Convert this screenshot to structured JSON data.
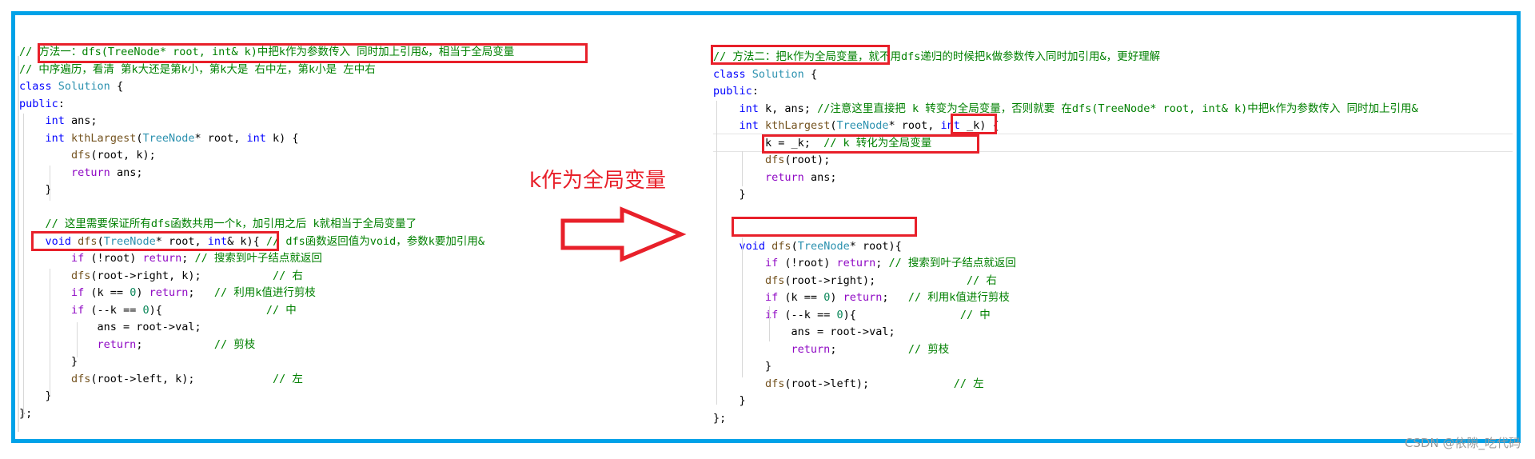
{
  "annotation": {
    "label": "k作为全局变量",
    "arrow_icon": "right-arrow",
    "accent_color": "#e8202a",
    "frame_color": "#00a2e8"
  },
  "left_panel": {
    "title": "方法一",
    "lines": [
      [
        {
          "t": "cm",
          "v": "// "
        },
        {
          "t": "cm",
          "v": "方法一：dfs(TreeNode* root, int& k)中把k作为参数传入 同时加上引用&，相当于全局变量"
        }
      ],
      [
        {
          "t": "cm",
          "v": "// 中序遍历，看清 第k大还是第k小，第k大是 右中左，第k小是 左中右"
        }
      ],
      [
        {
          "t": "kw",
          "v": "class "
        },
        {
          "t": "cls",
          "v": "Solution"
        },
        {
          "t": "txt",
          "v": " {"
        }
      ],
      [
        {
          "t": "kw",
          "v": "public"
        },
        {
          "t": "txt",
          "v": ":"
        }
      ],
      [
        {
          "t": "txt",
          "v": "    "
        },
        {
          "t": "kw",
          "v": "int"
        },
        {
          "t": "txt",
          "v": " ans;"
        }
      ],
      [
        {
          "t": "txt",
          "v": "    "
        },
        {
          "t": "kw",
          "v": "int"
        },
        {
          "t": "txt",
          "v": " "
        },
        {
          "t": "fn",
          "v": "kthLargest"
        },
        {
          "t": "txt",
          "v": "("
        },
        {
          "t": "cls",
          "v": "TreeNode"
        },
        {
          "t": "txt",
          "v": "* root, "
        },
        {
          "t": "kw",
          "v": "int"
        },
        {
          "t": "txt",
          "v": " k) {"
        }
      ],
      [
        {
          "t": "txt",
          "v": "        "
        },
        {
          "t": "fn",
          "v": "dfs"
        },
        {
          "t": "txt",
          "v": "(root, k);"
        }
      ],
      [
        {
          "t": "txt",
          "v": "        "
        },
        {
          "t": "ctl",
          "v": "return"
        },
        {
          "t": "txt",
          "v": " ans;"
        }
      ],
      [
        {
          "t": "txt",
          "v": "    }"
        }
      ],
      [
        {
          "t": "txt",
          "v": ""
        }
      ],
      [
        {
          "t": "txt",
          "v": "    "
        },
        {
          "t": "cm",
          "v": "// 这里需要保证所有dfs函数共用一个k，加引用之后 k就相当于全局变量了"
        }
      ],
      [
        {
          "t": "txt",
          "v": "    "
        },
        {
          "t": "kw",
          "v": "void"
        },
        {
          "t": "txt",
          "v": " "
        },
        {
          "t": "fn",
          "v": "dfs"
        },
        {
          "t": "txt",
          "v": "("
        },
        {
          "t": "cls",
          "v": "TreeNode"
        },
        {
          "t": "txt",
          "v": "* root, "
        },
        {
          "t": "kw",
          "v": "int"
        },
        {
          "t": "txt",
          "v": "& k){ "
        },
        {
          "t": "cm",
          "v": "// dfs函数返回值为void，参数k要加引用&"
        }
      ],
      [
        {
          "t": "txt",
          "v": "        "
        },
        {
          "t": "ctl",
          "v": "if"
        },
        {
          "t": "txt",
          "v": " (!root) "
        },
        {
          "t": "ctl",
          "v": "return"
        },
        {
          "t": "txt",
          "v": "; "
        },
        {
          "t": "cm",
          "v": "// 搜索到叶子结点就返回"
        }
      ],
      [
        {
          "t": "txt",
          "v": "        "
        },
        {
          "t": "fn",
          "v": "dfs"
        },
        {
          "t": "txt",
          "v": "(root->right, k);           "
        },
        {
          "t": "cm",
          "v": "// 右"
        }
      ],
      [
        {
          "t": "txt",
          "v": "        "
        },
        {
          "t": "ctl",
          "v": "if"
        },
        {
          "t": "txt",
          "v": " (k == "
        },
        {
          "t": "num",
          "v": "0"
        },
        {
          "t": "txt",
          "v": ") "
        },
        {
          "t": "ctl",
          "v": "return"
        },
        {
          "t": "txt",
          "v": ";   "
        },
        {
          "t": "cm",
          "v": "// 利用k值进行剪枝"
        }
      ],
      [
        {
          "t": "txt",
          "v": "        "
        },
        {
          "t": "ctl",
          "v": "if"
        },
        {
          "t": "txt",
          "v": " (--k == "
        },
        {
          "t": "num",
          "v": "0"
        },
        {
          "t": "txt",
          "v": "){                "
        },
        {
          "t": "cm",
          "v": "// 中"
        }
      ],
      [
        {
          "t": "txt",
          "v": "            ans = root->val;"
        }
      ],
      [
        {
          "t": "txt",
          "v": "            "
        },
        {
          "t": "ctl",
          "v": "return"
        },
        {
          "t": "txt",
          "v": ";           "
        },
        {
          "t": "cm",
          "v": "// 剪枝"
        }
      ],
      [
        {
          "t": "txt",
          "v": "        }"
        }
      ],
      [
        {
          "t": "txt",
          "v": "        "
        },
        {
          "t": "fn",
          "v": "dfs"
        },
        {
          "t": "txt",
          "v": "(root->left, k);            "
        },
        {
          "t": "cm",
          "v": "// 左"
        }
      ],
      [
        {
          "t": "txt",
          "v": "    }"
        }
      ],
      [
        {
          "t": "txt",
          "v": "};"
        }
      ]
    ]
  },
  "right_panel": {
    "title": "方法二",
    "lines": [
      [
        {
          "t": "cm",
          "v": "// 方法二：把k作为全局变量，就不用dfs递归的时候把k做参数传入同时加引用&，更好理解"
        }
      ],
      [
        {
          "t": "kw",
          "v": "class "
        },
        {
          "t": "cls",
          "v": "Solution"
        },
        {
          "t": "txt",
          "v": " {"
        }
      ],
      [
        {
          "t": "kw",
          "v": "public"
        },
        {
          "t": "txt",
          "v": ":"
        }
      ],
      [
        {
          "t": "txt",
          "v": "    "
        },
        {
          "t": "kw",
          "v": "int"
        },
        {
          "t": "txt",
          "v": " k, ans; "
        },
        {
          "t": "cm",
          "v": "//注意这里直接把 k 转变为全局变量，否则就要 在dfs(TreeNode* root, int& k)中把k作为参数传入 同时加上引用&"
        }
      ],
      [
        {
          "t": "txt",
          "v": "    "
        },
        {
          "t": "kw",
          "v": "int"
        },
        {
          "t": "txt",
          "v": " "
        },
        {
          "t": "fn",
          "v": "kthLargest"
        },
        {
          "t": "txt",
          "v": "("
        },
        {
          "t": "cls",
          "v": "TreeNode"
        },
        {
          "t": "txt",
          "v": "* root, "
        },
        {
          "t": "kw",
          "v": "int"
        },
        {
          "t": "txt",
          "v": " _k) {"
        }
      ],
      [
        {
          "t": "txt",
          "v": "        k = _k;  "
        },
        {
          "t": "cm",
          "v": "// k 转化为全局变量"
        }
      ],
      [
        {
          "t": "txt",
          "v": "        "
        },
        {
          "t": "fn",
          "v": "dfs"
        },
        {
          "t": "txt",
          "v": "(root);"
        }
      ],
      [
        {
          "t": "txt",
          "v": "        "
        },
        {
          "t": "ctl",
          "v": "return"
        },
        {
          "t": "txt",
          "v": " ans;"
        }
      ],
      [
        {
          "t": "txt",
          "v": "    }"
        }
      ],
      [
        {
          "t": "txt",
          "v": ""
        }
      ],
      [
        {
          "t": "txt",
          "v": ""
        }
      ],
      [
        {
          "t": "txt",
          "v": "    "
        },
        {
          "t": "kw",
          "v": "void"
        },
        {
          "t": "txt",
          "v": " "
        },
        {
          "t": "fn",
          "v": "dfs"
        },
        {
          "t": "txt",
          "v": "("
        },
        {
          "t": "cls",
          "v": "TreeNode"
        },
        {
          "t": "txt",
          "v": "* root){"
        }
      ],
      [
        {
          "t": "txt",
          "v": "        "
        },
        {
          "t": "ctl",
          "v": "if"
        },
        {
          "t": "txt",
          "v": " (!root) "
        },
        {
          "t": "ctl",
          "v": "return"
        },
        {
          "t": "txt",
          "v": "; "
        },
        {
          "t": "cm",
          "v": "// 搜索到叶子结点就返回"
        }
      ],
      [
        {
          "t": "txt",
          "v": "        "
        },
        {
          "t": "fn",
          "v": "dfs"
        },
        {
          "t": "txt",
          "v": "(root->right);              "
        },
        {
          "t": "cm",
          "v": "// 右"
        }
      ],
      [
        {
          "t": "txt",
          "v": "        "
        },
        {
          "t": "ctl",
          "v": "if"
        },
        {
          "t": "txt",
          "v": " (k == "
        },
        {
          "t": "num",
          "v": "0"
        },
        {
          "t": "txt",
          "v": ") "
        },
        {
          "t": "ctl",
          "v": "return"
        },
        {
          "t": "txt",
          "v": ";   "
        },
        {
          "t": "cm",
          "v": "// 利用k值进行剪枝"
        }
      ],
      [
        {
          "t": "txt",
          "v": "        "
        },
        {
          "t": "ctl",
          "v": "if"
        },
        {
          "t": "txt",
          "v": " (--k == "
        },
        {
          "t": "num",
          "v": "0"
        },
        {
          "t": "txt",
          "v": "){                "
        },
        {
          "t": "cm",
          "v": "// 中"
        }
      ],
      [
        {
          "t": "txt",
          "v": "            ans = root->val;"
        }
      ],
      [
        {
          "t": "txt",
          "v": "            "
        },
        {
          "t": "ctl",
          "v": "return"
        },
        {
          "t": "txt",
          "v": ";           "
        },
        {
          "t": "cm",
          "v": "// 剪枝"
        }
      ],
      [
        {
          "t": "txt",
          "v": "        }"
        }
      ],
      [
        {
          "t": "txt",
          "v": "        "
        },
        {
          "t": "fn",
          "v": "dfs"
        },
        {
          "t": "txt",
          "v": "(root->left);             "
        },
        {
          "t": "cm",
          "v": "// 左"
        }
      ],
      [
        {
          "t": "txt",
          "v": "    }"
        }
      ],
      [
        {
          "t": "txt",
          "v": "};"
        }
      ]
    ]
  },
  "watermark": "CSDN @依隙_吃代码"
}
